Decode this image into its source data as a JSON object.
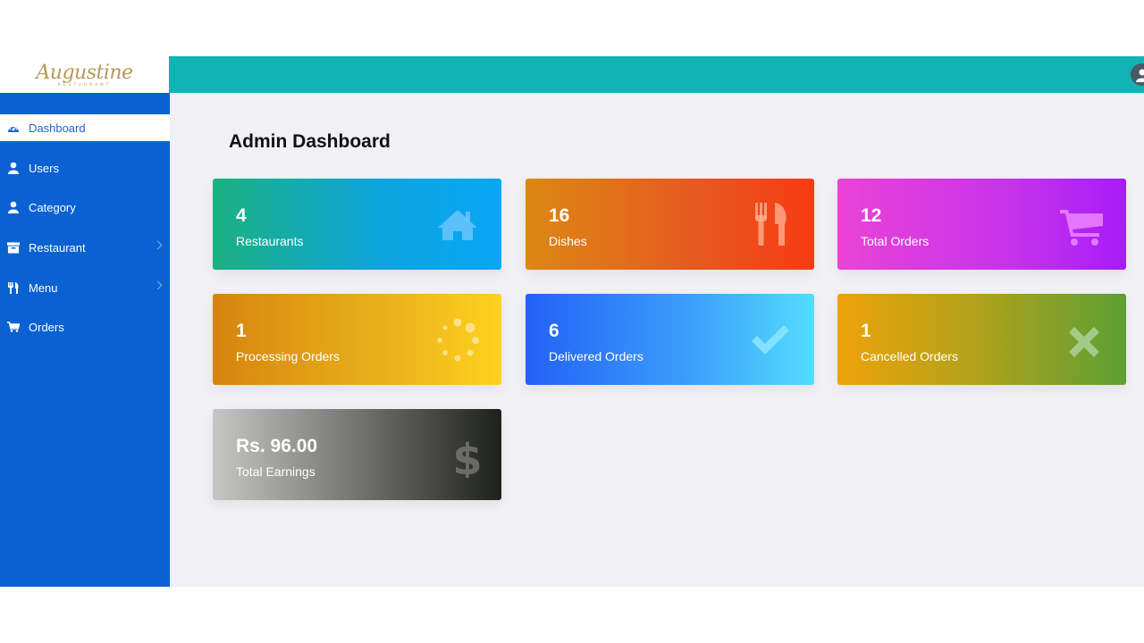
{
  "brand": {
    "logo_script": "Augustine",
    "logo_sub": "RESTAURANT"
  },
  "sidebar": {
    "items": [
      {
        "label": "Dashboard",
        "icon": "dashboard-icon",
        "active": true
      },
      {
        "label": "Users",
        "icon": "user-icon"
      },
      {
        "label": "Category",
        "icon": "user-icon"
      },
      {
        "label": "Restaurant",
        "icon": "archive-icon",
        "has_submenu": true
      },
      {
        "label": "Menu",
        "icon": "cutlery-icon",
        "has_submenu": true
      },
      {
        "label": "Orders",
        "icon": "cart-icon"
      }
    ]
  },
  "main": {
    "title": "Admin Dashboard",
    "cards": [
      {
        "value": "4",
        "label": "Restaurants",
        "icon": "home-icon"
      },
      {
        "value": "16",
        "label": "Dishes",
        "icon": "cutlery-icon"
      },
      {
        "value": "12",
        "label": "Total Orders",
        "icon": "cart-icon"
      },
      {
        "value": "1",
        "label": "Processing Orders",
        "icon": "spinner-icon"
      },
      {
        "value": "6",
        "label": "Delivered Orders",
        "icon": "check-icon"
      },
      {
        "value": "1",
        "label": "Cancelled Orders",
        "icon": "close-icon"
      },
      {
        "value": "Rs. 96.00",
        "label": "Total Earnings",
        "icon": "dollar-icon"
      }
    ]
  },
  "colors": {
    "topbar": "#11b3b5",
    "sidebar": "#0b61d1",
    "background": "#f0f0f5"
  }
}
